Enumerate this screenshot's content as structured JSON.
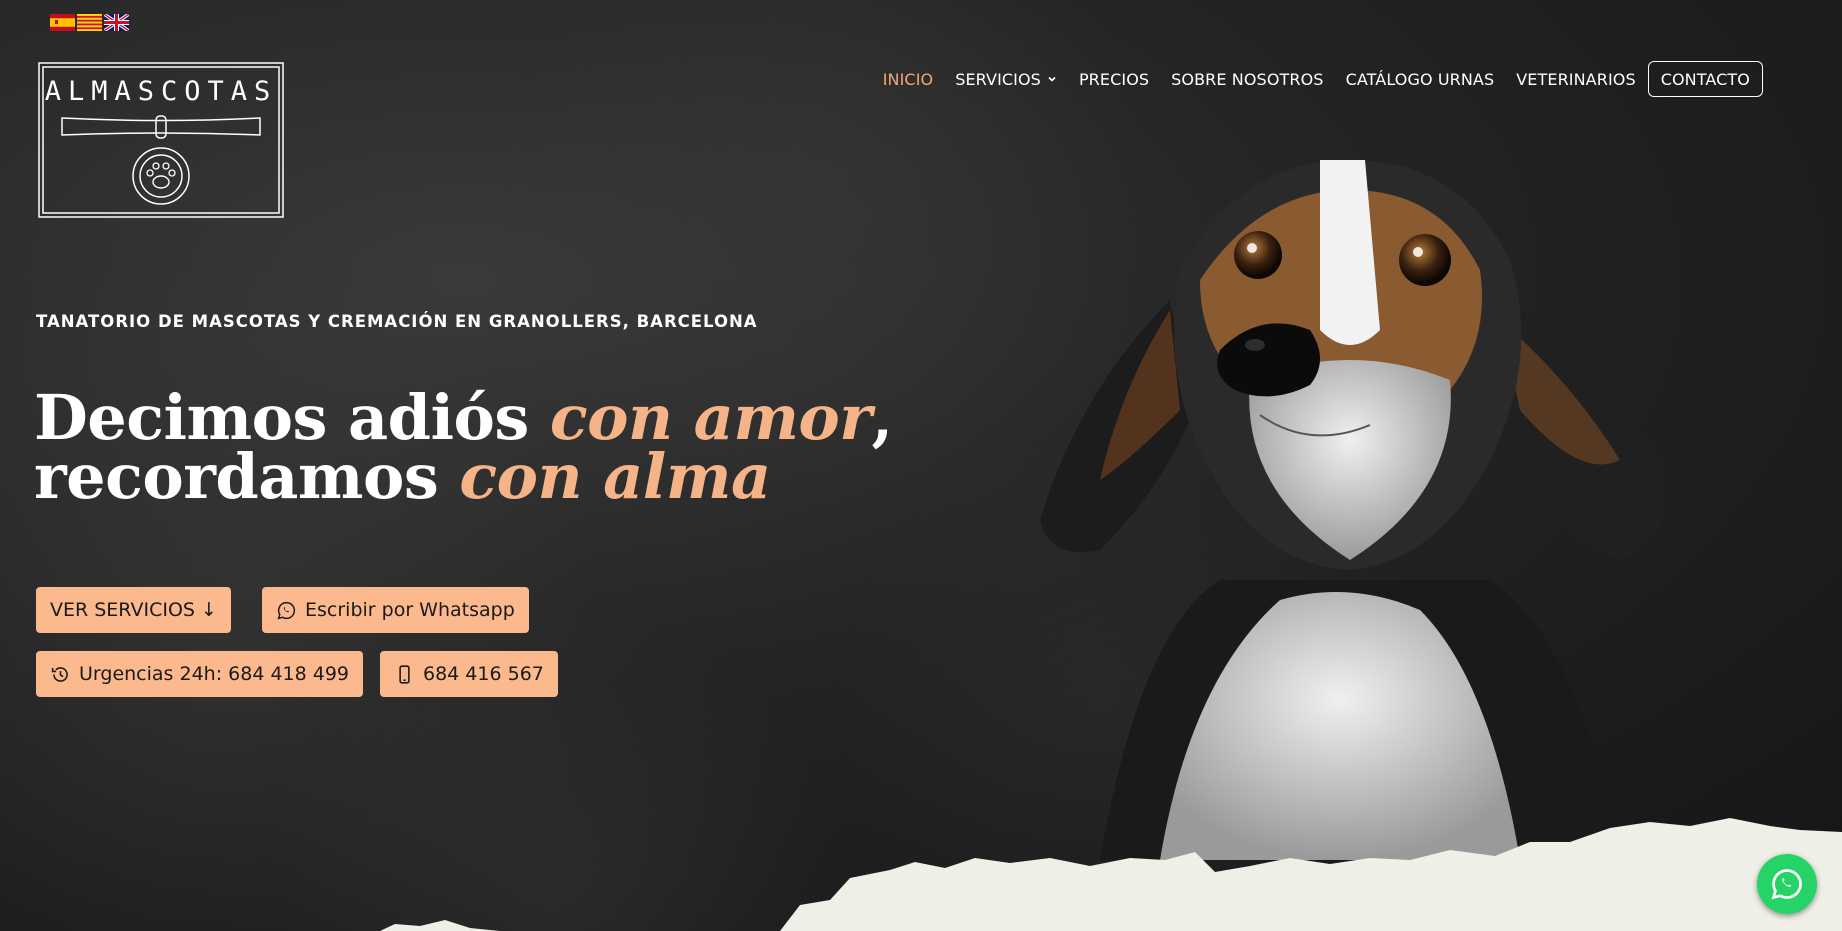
{
  "languages": [
    {
      "name": "Español",
      "icon": "spain-flag-icon"
    },
    {
      "name": "Català",
      "icon": "catalonia-flag-icon"
    },
    {
      "name": "English",
      "icon": "uk-flag-icon"
    }
  ],
  "logo": {
    "text": "ALMASCOTAS",
    "icon": "paw-tag-logo"
  },
  "nav": {
    "items": [
      {
        "label": "INICIO",
        "active": true
      },
      {
        "label": "SERVICIOS",
        "has_dropdown": true
      },
      {
        "label": "PRECIOS"
      },
      {
        "label": "SOBRE NOSOTROS"
      },
      {
        "label": "CATÁLOGO URNAS"
      },
      {
        "label": "VETERINARIOS"
      },
      {
        "label": "CONTACTO",
        "boxed": true
      }
    ]
  },
  "hero": {
    "tagline": "TANATORIO DE MASCOTAS Y CREMACIÓN EN GRANOLLERS, BARCELONA",
    "headline": {
      "line1_plain": "Decimos adiós ",
      "line1_accent": "con amor",
      "line1_end": ",",
      "line2_plain": "recordamos ",
      "line2_accent": "con alma"
    },
    "buttons": {
      "services": "VER SERVICIOS ↓",
      "whatsapp": "Escribir por Whatsapp",
      "urgent": "Urgencias 24h: 684 418 499",
      "phone": "684 416 567"
    }
  },
  "colors": {
    "accent": "#f4a676",
    "button_bg": "#fbb98d",
    "background": "#1e1e1e",
    "whatsapp": "#25d366"
  },
  "floating": {
    "whatsapp_icon": "whatsapp-icon"
  }
}
